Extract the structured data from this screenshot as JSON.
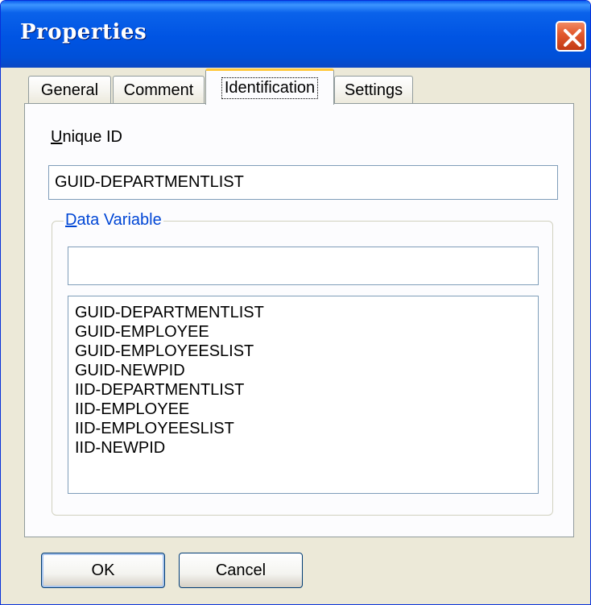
{
  "window": {
    "title": "Properties"
  },
  "tabs": [
    {
      "label": "General"
    },
    {
      "label": "Comment"
    },
    {
      "label": "Identification"
    },
    {
      "label": "Settings"
    }
  ],
  "identification": {
    "unique_id_label_mnemonic": "U",
    "unique_id_label_rest": "nique ID",
    "unique_id_value": "GUID-DEPARTMENTLIST",
    "data_variable_label_mnemonic": "D",
    "data_variable_label_rest": "ata Variable",
    "data_variable_value": "",
    "variables": [
      "GUID-DEPARTMENTLIST",
      "GUID-EMPLOYEE",
      "GUID-EMPLOYEESLIST",
      "GUID-NEWPID",
      "IID-DEPARTMENTLIST",
      "IID-EMPLOYEE",
      "IID-EMPLOYEESLIST",
      "IID-NEWPID"
    ]
  },
  "buttons": {
    "ok": "OK",
    "cancel": "Cancel"
  },
  "colors": {
    "titlebar": "#0054e3",
    "face": "#ece9d8",
    "active_tab_highlight": "#ffc83c",
    "close_button": "#e35a2e",
    "group_label": "#0046d5"
  },
  "icons": {
    "close": "close-icon"
  }
}
